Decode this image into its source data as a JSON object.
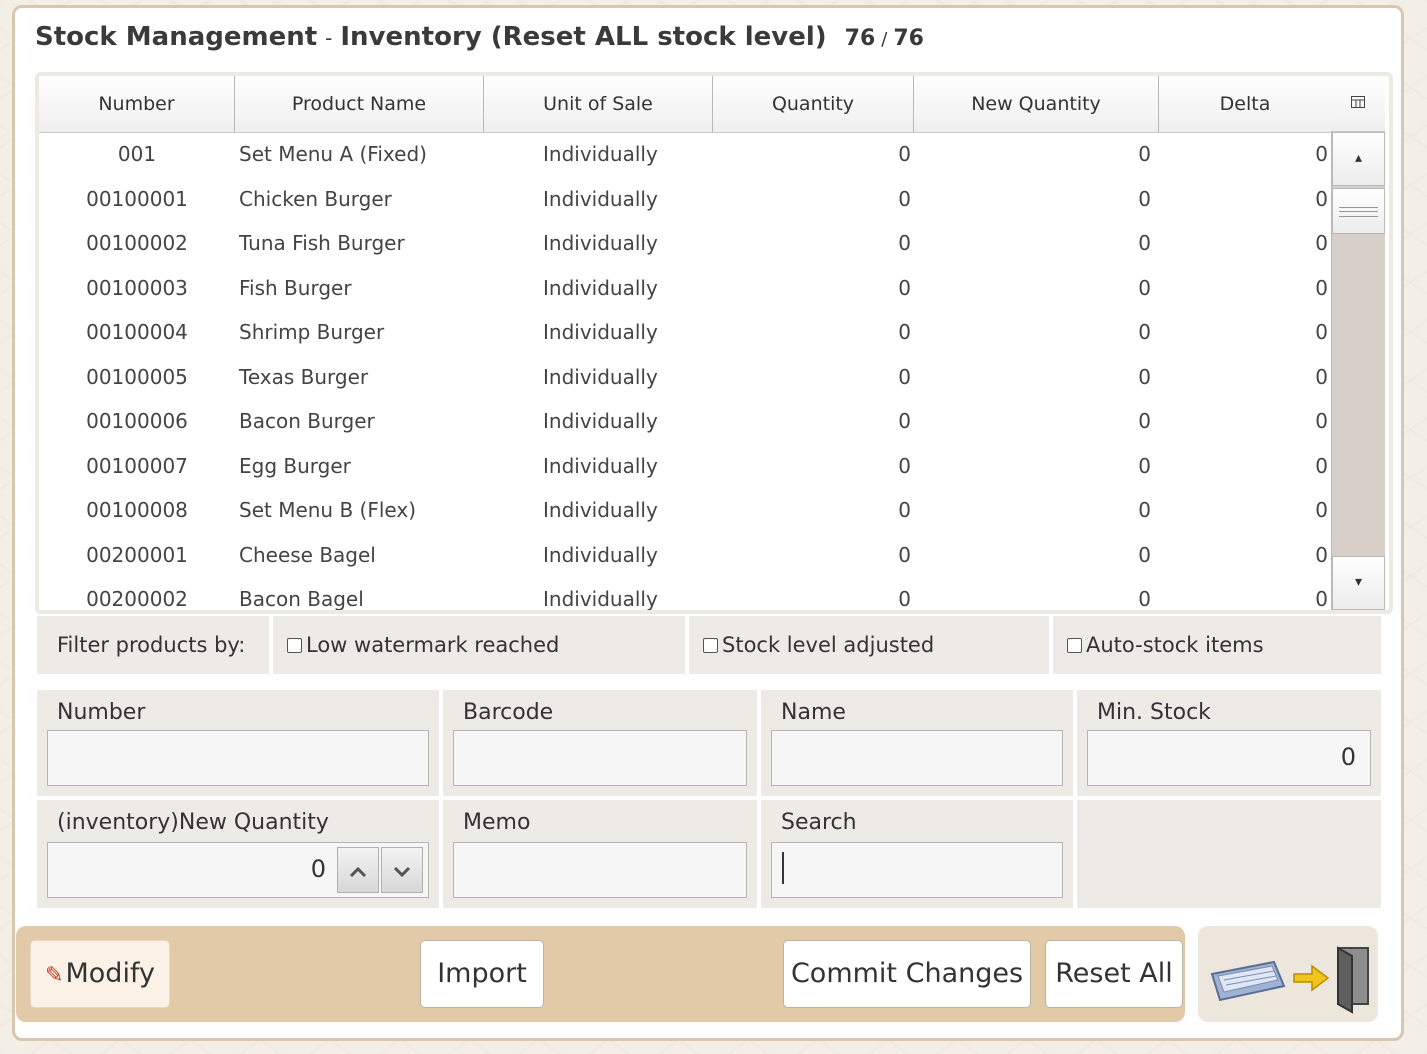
{
  "header": {
    "module": "Stock Management",
    "separator": "-",
    "view": "Inventory (Reset ALL stock level)",
    "shown": "76",
    "slash": "/",
    "total": "76"
  },
  "table": {
    "columns": [
      "Number",
      "Product Name",
      "Unit of Sale",
      "Quantity",
      "New Quantity",
      "Delta"
    ],
    "corner_icon": "column-chooser-icon",
    "rows": [
      {
        "number": "001",
        "name": "Set Menu A (Fixed)",
        "unit": "Individually",
        "quantity": "0",
        "new_quantity": "0",
        "delta": "0"
      },
      {
        "number": "00100001",
        "name": "Chicken Burger",
        "unit": "Individually",
        "quantity": "0",
        "new_quantity": "0",
        "delta": "0"
      },
      {
        "number": "00100002",
        "name": "Tuna Fish Burger",
        "unit": "Individually",
        "quantity": "0",
        "new_quantity": "0",
        "delta": "0"
      },
      {
        "number": "00100003",
        "name": "Fish Burger",
        "unit": "Individually",
        "quantity": "0",
        "new_quantity": "0",
        "delta": "0"
      },
      {
        "number": "00100004",
        "name": "Shrimp Burger",
        "unit": "Individually",
        "quantity": "0",
        "new_quantity": "0",
        "delta": "0"
      },
      {
        "number": "00100005",
        "name": "Texas Burger",
        "unit": "Individually",
        "quantity": "0",
        "new_quantity": "0",
        "delta": "0"
      },
      {
        "number": "00100006",
        "name": "Bacon Burger",
        "unit": "Individually",
        "quantity": "0",
        "new_quantity": "0",
        "delta": "0"
      },
      {
        "number": "00100007",
        "name": "Egg Burger",
        "unit": "Individually",
        "quantity": "0",
        "new_quantity": "0",
        "delta": "0"
      },
      {
        "number": "00100008",
        "name": "Set Menu B (Flex)",
        "unit": "Individually",
        "quantity": "0",
        "new_quantity": "0",
        "delta": "0"
      },
      {
        "number": "00200001",
        "name": "Cheese Bagel",
        "unit": "Individually",
        "quantity": "0",
        "new_quantity": "0",
        "delta": "0"
      },
      {
        "number": "00200002",
        "name": "Bacon Bagel",
        "unit": "Individually",
        "quantity": "0",
        "new_quantity": "0",
        "delta": "0"
      }
    ]
  },
  "filter": {
    "label": "Filter products by:",
    "options": [
      {
        "label": "Low watermark reached",
        "checked": false
      },
      {
        "label": "Stock level adjusted",
        "checked": false
      },
      {
        "label": "Auto-stock items",
        "checked": false
      }
    ]
  },
  "form": {
    "number": {
      "label": "Number",
      "value": ""
    },
    "barcode": {
      "label": "Barcode",
      "value": ""
    },
    "name": {
      "label": "Name",
      "value": ""
    },
    "min_stock": {
      "label": "Min. Stock",
      "value": "0"
    },
    "new_quantity": {
      "label": "(inventory)New Quantity",
      "value": "0"
    },
    "memo": {
      "label": "Memo",
      "value": ""
    },
    "search": {
      "label": "Search",
      "value": ""
    }
  },
  "actions": {
    "modify": "Modify",
    "import": "Import",
    "commit": "Commit Changes",
    "reset_all": "Reset All"
  },
  "colors": {
    "action_bar": "#e2c9a7",
    "panel": "#edebe6",
    "window_border": "#d8c6ad"
  }
}
